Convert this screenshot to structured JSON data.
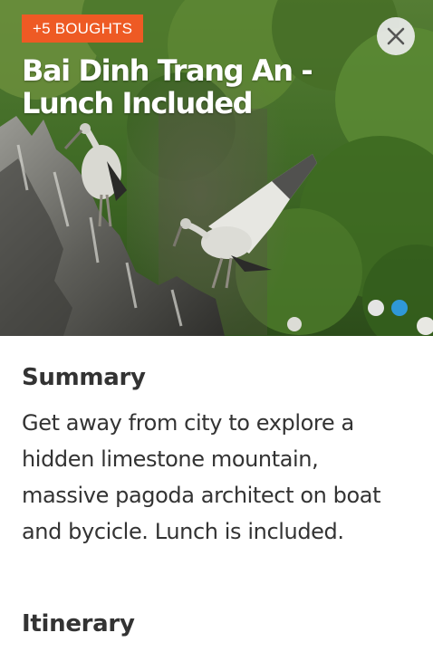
{
  "tour": {
    "bought_badge": "+5 BOUGHTS",
    "title": "Bai Dinh Trang An - Lunch Included"
  },
  "hero": {
    "close_icon": "close-icon",
    "carousel": {
      "total_slides": 2,
      "active_slide": 2
    }
  },
  "summary": {
    "heading": "Summary",
    "text": "Get away from city to explore a hidden limestone mountain, massive pagoda architect on boat and bycicle. Lunch is included."
  },
  "itinerary": {
    "heading": "Itinerary"
  },
  "colors": {
    "badge": "#ee5a24",
    "active_dot": "#2f98d8",
    "inactive_dot": "#e4e4e4",
    "text": "#333333"
  }
}
